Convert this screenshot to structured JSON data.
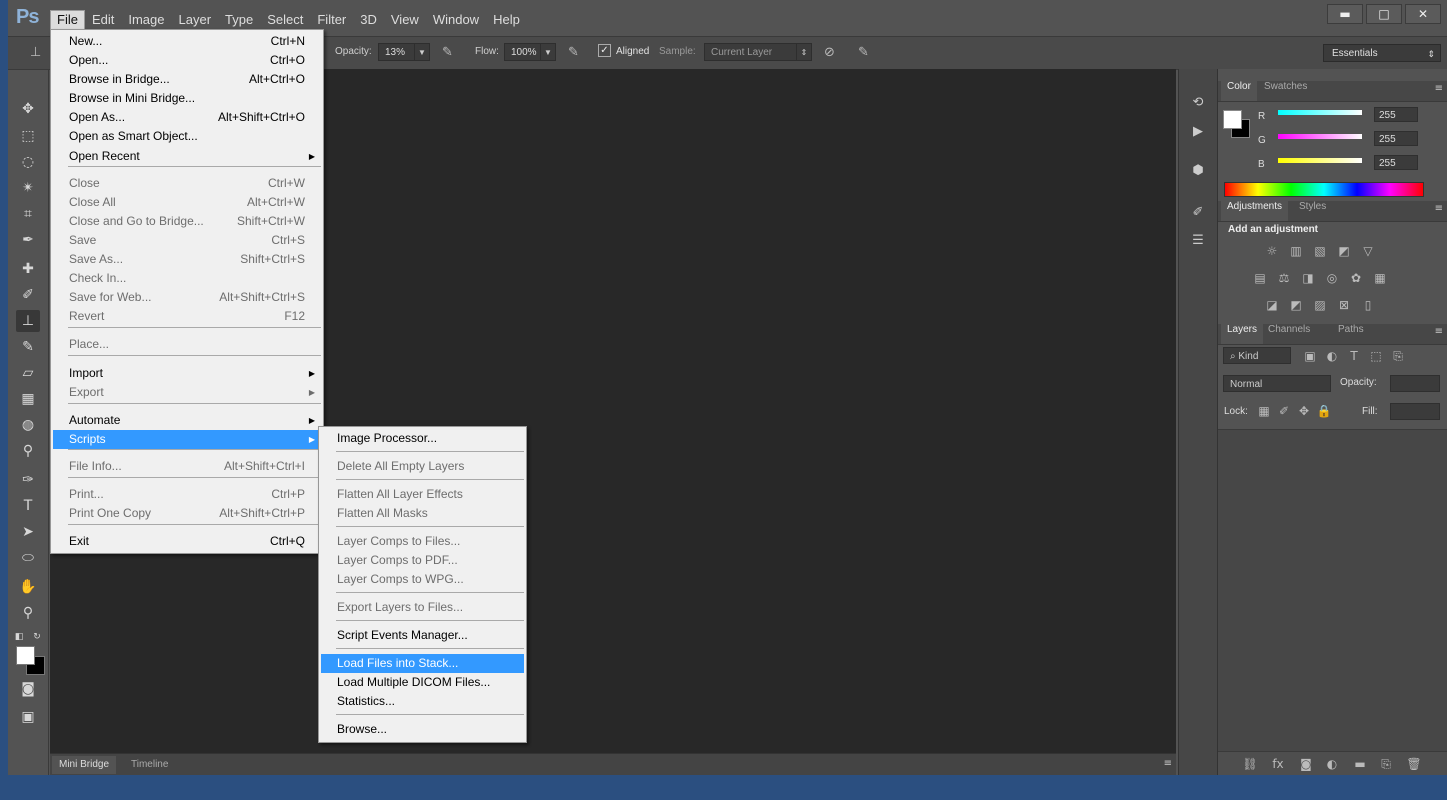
{
  "app": {
    "logo": "Ps"
  },
  "menubar": [
    "File",
    "Edit",
    "Image",
    "Layer",
    "Type",
    "Select",
    "Filter",
    "3D",
    "View",
    "Window",
    "Help"
  ],
  "window_buttons": [
    "▬",
    "□",
    "✕"
  ],
  "options": {
    "opacity_label": "Opacity:",
    "opacity_value": "13%",
    "flow_label": "Flow:",
    "flow_value": "100%",
    "aligned_label": "Aligned",
    "sample_label": "Sample:",
    "sample_value": "Current Layer",
    "workspace": "Essentials"
  },
  "file_menu": [
    {
      "label": "New...",
      "shortcut": "Ctrl+N",
      "disabled": false
    },
    {
      "label": "Open...",
      "shortcut": "Ctrl+O",
      "disabled": false
    },
    {
      "label": "Browse in Bridge...",
      "shortcut": "Alt+Ctrl+O",
      "disabled": false
    },
    {
      "label": "Browse in Mini Bridge...",
      "shortcut": "",
      "disabled": false
    },
    {
      "label": "Open As...",
      "shortcut": "Alt+Shift+Ctrl+O",
      "disabled": false
    },
    {
      "label": "Open as Smart Object...",
      "shortcut": "",
      "disabled": false
    },
    {
      "label": "Open Recent",
      "shortcut": "",
      "disabled": false,
      "submenu": true
    },
    {
      "label": "Close",
      "shortcut": "Ctrl+W",
      "disabled": true
    },
    {
      "label": "Close All",
      "shortcut": "Alt+Ctrl+W",
      "disabled": true
    },
    {
      "label": "Close and Go to Bridge...",
      "shortcut": "Shift+Ctrl+W",
      "disabled": true
    },
    {
      "label": "Save",
      "shortcut": "Ctrl+S",
      "disabled": true
    },
    {
      "label": "Save As...",
      "shortcut": "Shift+Ctrl+S",
      "disabled": true
    },
    {
      "label": "Check In...",
      "shortcut": "",
      "disabled": true
    },
    {
      "label": "Save for Web...",
      "shortcut": "Alt+Shift+Ctrl+S",
      "disabled": true
    },
    {
      "label": "Revert",
      "shortcut": "F12",
      "disabled": true
    },
    {
      "label": "Place...",
      "shortcut": "",
      "disabled": true
    },
    {
      "label": "Import",
      "shortcut": "",
      "disabled": false,
      "submenu": true
    },
    {
      "label": "Export",
      "shortcut": "",
      "disabled": true,
      "submenu": true
    },
    {
      "label": "Automate",
      "shortcut": "",
      "disabled": false,
      "submenu": true
    },
    {
      "label": "Scripts",
      "shortcut": "",
      "disabled": false,
      "submenu": true,
      "highlight": true
    },
    {
      "label": "File Info...",
      "shortcut": "Alt+Shift+Ctrl+I",
      "disabled": true
    },
    {
      "label": "Print...",
      "shortcut": "Ctrl+P",
      "disabled": true
    },
    {
      "label": "Print One Copy",
      "shortcut": "Alt+Shift+Ctrl+P",
      "disabled": true
    },
    {
      "label": "Exit",
      "shortcut": "Ctrl+Q",
      "disabled": false
    }
  ],
  "scripts_menu": [
    {
      "label": "Image Processor...",
      "disabled": false
    },
    {
      "label": "Delete All Empty Layers",
      "disabled": true
    },
    {
      "label": "Flatten All Layer Effects",
      "disabled": true
    },
    {
      "label": "Flatten All Masks",
      "disabled": true
    },
    {
      "label": "Layer Comps to Files...",
      "disabled": true
    },
    {
      "label": "Layer Comps to PDF...",
      "disabled": true
    },
    {
      "label": "Layer Comps to WPG...",
      "disabled": true
    },
    {
      "label": "Export Layers to Files...",
      "disabled": true
    },
    {
      "label": "Script Events Manager...",
      "disabled": false
    },
    {
      "label": "Load Files into Stack...",
      "disabled": false,
      "highlight": true
    },
    {
      "label": "Load Multiple DICOM Files...",
      "disabled": false
    },
    {
      "label": "Statistics...",
      "disabled": false
    },
    {
      "label": "Browse...",
      "disabled": false
    }
  ],
  "color_panel": {
    "tabs": [
      "Color",
      "Swatches"
    ],
    "channels": [
      {
        "name": "R",
        "value": "255",
        "gradient": "#00ffff"
      },
      {
        "name": "G",
        "value": "255",
        "gradient": "#ff00ff"
      },
      {
        "name": "B",
        "value": "255",
        "gradient": "#ffff00"
      }
    ]
  },
  "adjustments_panel": {
    "tabs": [
      "Adjustments",
      "Styles"
    ],
    "heading": "Add an adjustment"
  },
  "layers_panel": {
    "tabs": [
      "Layers",
      "Channels",
      "Paths"
    ],
    "kind_label": "Kind",
    "blend_mode": "Normal",
    "opacity_label": "Opacity:",
    "lock_label": "Lock:",
    "fill_label": "Fill:"
  },
  "bottom_tabs": [
    "Mini Bridge",
    "Timeline"
  ]
}
